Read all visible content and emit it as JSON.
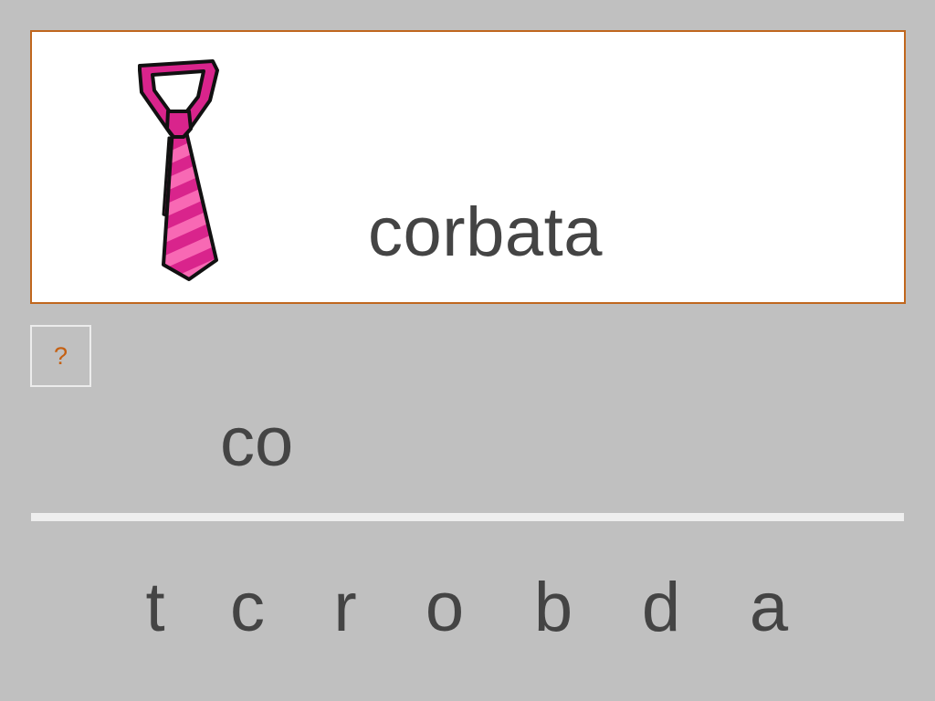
{
  "card": {
    "word": "corbata",
    "picture_icon": "pink-striped-necktie-icon"
  },
  "hint_button": {
    "label": "?"
  },
  "answer": {
    "typed": "co"
  },
  "letters": [
    "t",
    "c",
    "r",
    "o",
    "b",
    "d",
    "a"
  ],
  "colors": {
    "background": "#c0c0c0",
    "card_border": "#c0671e",
    "text": "#444444",
    "hint": "#c56012",
    "tie_dark": "#d9248c",
    "tie_light": "#f869b4"
  }
}
